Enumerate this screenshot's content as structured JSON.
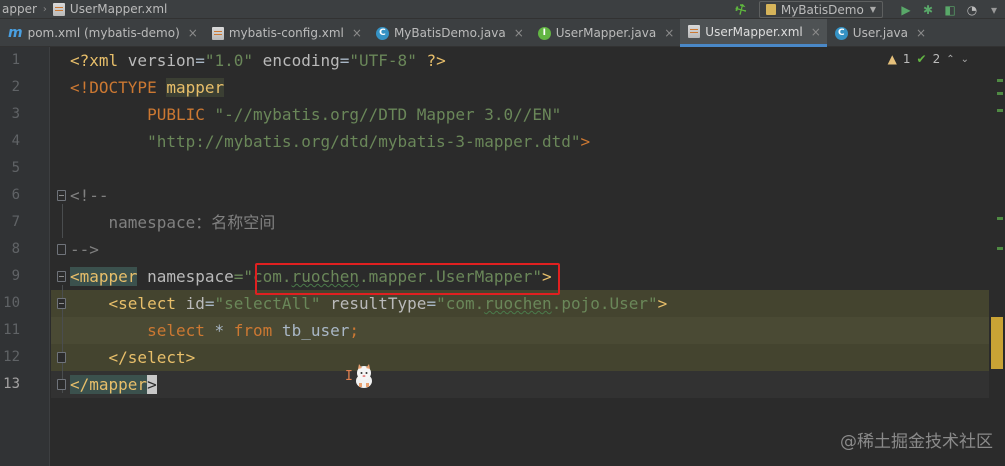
{
  "navbar": {
    "breadcrumb": [
      "apper",
      "UserMapper.xml"
    ],
    "run_config": "MyBatisDemo"
  },
  "tabs": [
    {
      "label": "pom.xml (mybatis-demo)",
      "icon": "maven-icon"
    },
    {
      "label": "mybatis-config.xml",
      "icon": "xml-file-icon"
    },
    {
      "label": "MyBatisDemo.java",
      "icon": "java-class-icon"
    },
    {
      "label": "UserMapper.java",
      "icon": "java-interface-icon"
    },
    {
      "label": "UserMapper.xml",
      "icon": "xml-file-icon",
      "active": true
    },
    {
      "label": "User.java",
      "icon": "java-class-icon"
    }
  ],
  "inspections": {
    "warnings": "1",
    "ok": "2"
  },
  "line_numbers": [
    "1",
    "2",
    "3",
    "4",
    "5",
    "6",
    "7",
    "8",
    "9",
    "10",
    "11",
    "12",
    "13"
  ],
  "code": {
    "l1": {
      "a": "<?xml ",
      "b": "version",
      "c": "=",
      "d": "\"1.0\"",
      "e": " encoding",
      "f": "=",
      "g": "\"UTF-8\"",
      "h": " ?>"
    },
    "l2": {
      "a": "<!DOCTYPE ",
      "b": "mapper"
    },
    "l3": {
      "indent": "        ",
      "a": "PUBLIC ",
      "b": "\"-//mybatis.org//DTD Mapper 3.0//EN\""
    },
    "l4": {
      "indent": "        ",
      "a": "\"http://mybatis.org/dtd/mybatis-3-mapper.dtd\"",
      "b": ">"
    },
    "l6": {
      "a": "<!--"
    },
    "l7": {
      "indent": "    ",
      "a": "namespace：名称空间"
    },
    "l8": {
      "a": "-->"
    },
    "l9": {
      "a": "<",
      "b": "mapper",
      "c": " namespace",
      "d": "=\"",
      "e1": "com.",
      "e2": "ruochen",
      "e3": ".mapper.UserMapper",
      "f": "\"",
      "g": ">"
    },
    "l10": {
      "indent": "    ",
      "a": "<select ",
      "b": "id",
      "c": "=",
      "d": "\"selectAll\"",
      "e": " resultType",
      "f": "=",
      "g1": "\"com.",
      "g2": "ruochen",
      "g3": ".pojo.User\"",
      "h": ">"
    },
    "l11": {
      "indent": "        ",
      "a": "select",
      "b": " * ",
      "c": "from",
      "d": " tb_user",
      "e": ";"
    },
    "l12": {
      "indent": "    ",
      "a": "</select>"
    },
    "l13": {
      "a": "</mapper",
      "b": ">"
    }
  },
  "watermark": "@稀土掘金技术社区"
}
